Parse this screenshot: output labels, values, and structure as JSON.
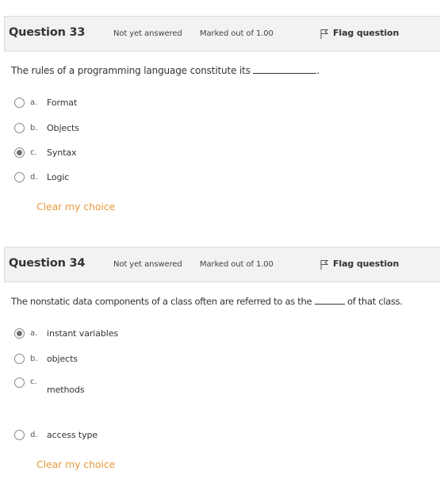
{
  "questions": [
    {
      "title": "Question 33",
      "state": "Not yet answered",
      "mark": "Marked out of 1.00",
      "flag_label": "Flag question",
      "text_before": "The rules of a programming language constitute its",
      "text_after": ".",
      "options": [
        {
          "letter": "a.",
          "label": "Format",
          "selected": false
        },
        {
          "letter": "b.",
          "label": "Objects",
          "selected": false
        },
        {
          "letter": "c.",
          "label": "Syntax",
          "selected": true
        },
        {
          "letter": "d.",
          "label": "Logic",
          "selected": false
        }
      ],
      "clear_label": "Clear my choice"
    },
    {
      "title": "Question 34",
      "state": "Not yet answered",
      "mark": "Marked out of 1.00",
      "flag_label": "Flag question",
      "text_before": "The nonstatic data components of a class often are referred to as the",
      "text_after": "of that class.",
      "options": [
        {
          "letter": "a.",
          "label": "instant variables",
          "selected": true
        },
        {
          "letter": "b.",
          "label": "objects",
          "selected": false
        },
        {
          "letter": "c.",
          "label": "methods",
          "selected": false
        },
        {
          "letter": "d.",
          "label": "access type",
          "selected": false
        }
      ],
      "clear_label": "Clear my choice"
    }
  ],
  "icons": {
    "flag": "flag-icon",
    "radio": "radio-button"
  },
  "colors": {
    "link": "#e89a3c",
    "header_bg": "#f2f2f2",
    "radio_fill": "#6f6f6f"
  }
}
